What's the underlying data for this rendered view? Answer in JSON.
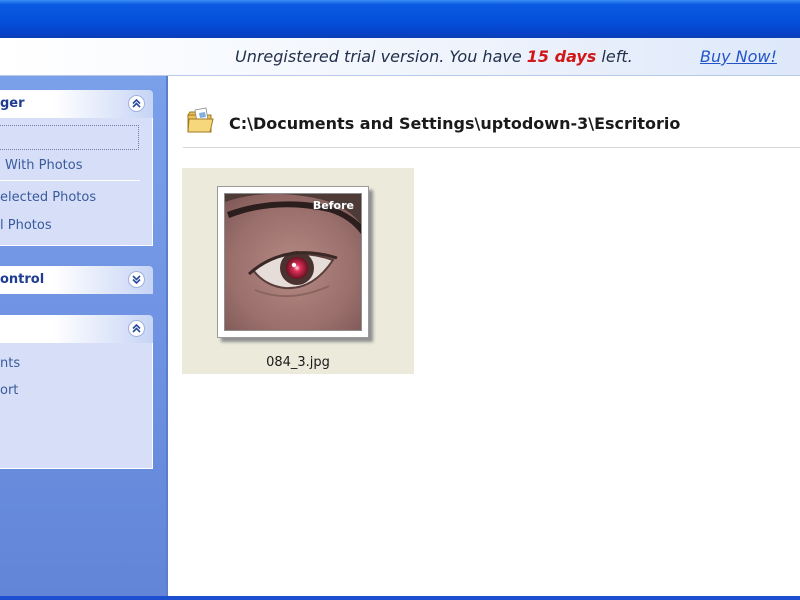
{
  "banner": {
    "text_before": "Unregistered trial version. You have ",
    "days": "15 days",
    "text_after": " left.",
    "buy_link": "Buy Now!"
  },
  "sidebar": {
    "panels": [
      {
        "title": "ger",
        "expanded": true,
        "items": [
          "With Photos",
          "elected Photos",
          "l Photos"
        ]
      },
      {
        "title": "ontrol",
        "expanded": false,
        "items": []
      },
      {
        "title": "",
        "expanded": true,
        "items": [
          "nts",
          "ort"
        ]
      }
    ]
  },
  "main": {
    "path": "C:\\Documents and Settings\\uptodown-3\\Escritorio",
    "thumbnails": [
      {
        "filename": "084_3.jpg",
        "tag": "Before"
      }
    ]
  },
  "colors": {
    "titlebar": "#0550dc",
    "taskpane": "#6f93e2",
    "days_highlight": "#d01818",
    "link": "#2455c8",
    "thumb_cell": "#ebeadb"
  }
}
